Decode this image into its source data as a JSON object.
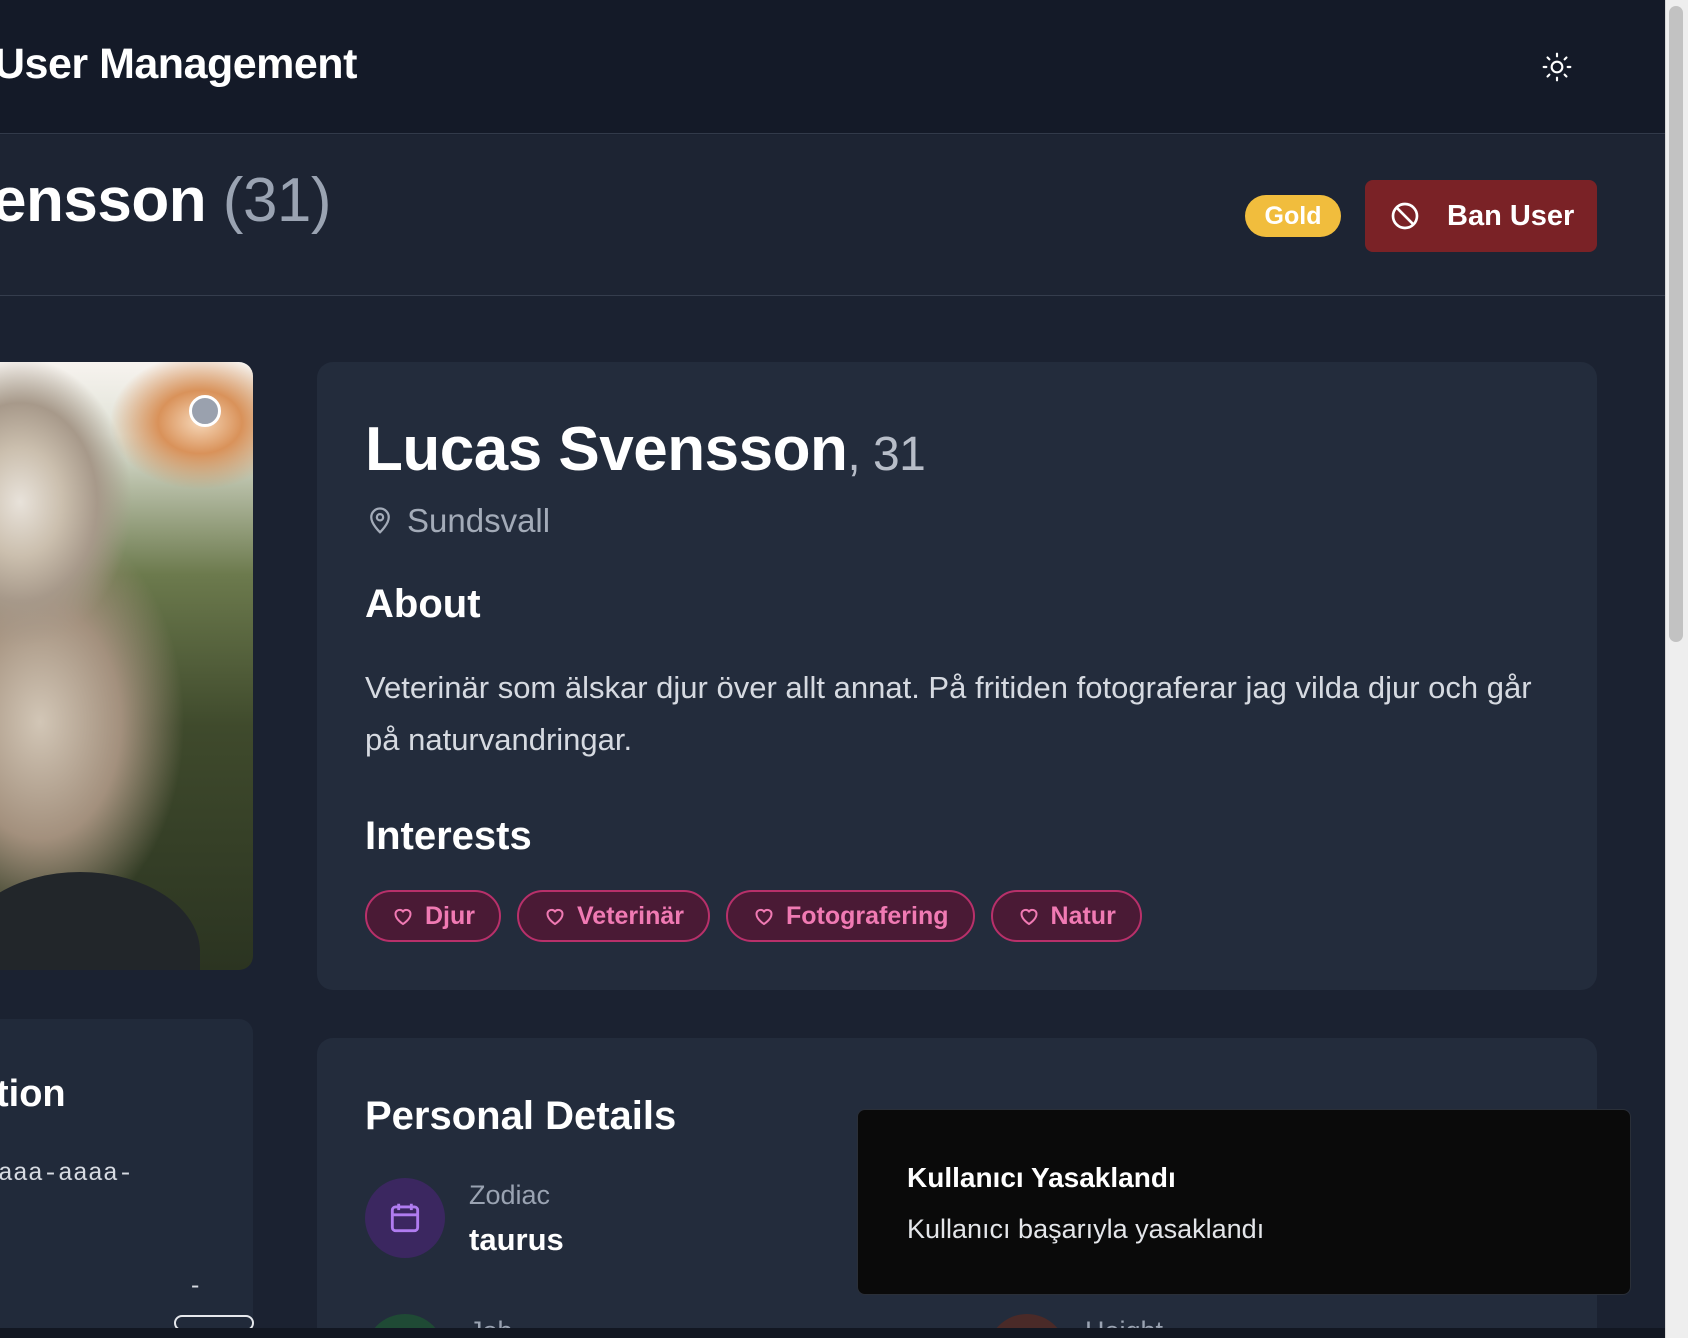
{
  "header": {
    "title": "User Management",
    "theme_icon": "sun-icon"
  },
  "subheader": {
    "name": "ensson",
    "age": "(31)",
    "badge": "Gold",
    "ban_button": {
      "label": "Ban User",
      "icon": "ban-icon"
    }
  },
  "profile": {
    "name": "Lucas Svensson",
    "age": ", 31",
    "location": "Sundsvall",
    "about_heading": "About",
    "about_text": "Veterinär som älskar djur över allt annat. På fritiden fotograferar jag vilda djur och går på naturvandringar.",
    "interests_heading": "Interests",
    "interests": [
      {
        "label": "Djur"
      },
      {
        "label": "Veterinär"
      },
      {
        "label": "Fotografering"
      },
      {
        "label": "Natur"
      }
    ]
  },
  "left_card": {
    "title": "tion",
    "id_fragment": "aaa-aaaa-",
    "dash": "-"
  },
  "personal_details": {
    "heading": "Personal Details",
    "zodiac": {
      "label": "Zodiac",
      "value": "taurus"
    },
    "job": {
      "label": "Job"
    },
    "height": {
      "label": "Height"
    }
  },
  "toast": {
    "title": "Kullanıcı Yasaklandı",
    "description": "Kullanıcı başarıyla yasaklandı"
  },
  "colors": {
    "background": "#1b2231",
    "card": "#232c3c",
    "ban_button": "#7a2226",
    "gold_badge": "#f1bd3d",
    "chip_border": "#b8306a",
    "chip_text": "#f07ab3"
  }
}
